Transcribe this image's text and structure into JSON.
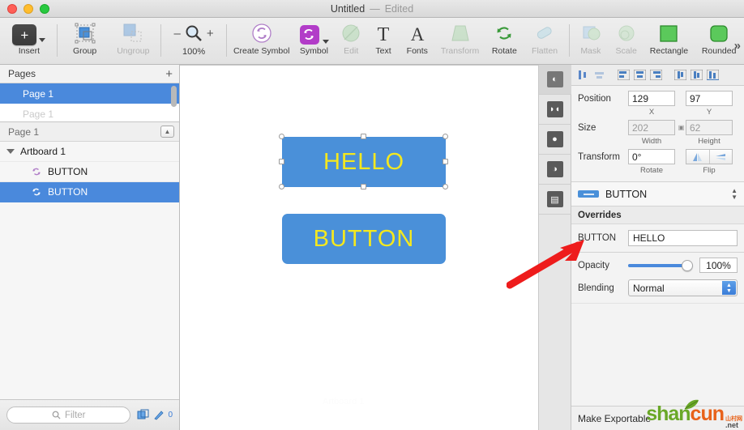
{
  "window": {
    "title": "Untitled",
    "separator": "—",
    "state": "Edited",
    "traffic": [
      "close",
      "minimize",
      "zoom"
    ]
  },
  "toolbar": {
    "items": [
      {
        "label": "Insert",
        "icon": "plus-square-icon",
        "enabled": true,
        "has_caret": true
      },
      {
        "label": "Group",
        "icon": "group-icon",
        "enabled": true
      },
      {
        "label": "Ungroup",
        "icon": "ungroup-icon",
        "enabled": false
      },
      {
        "label": "Create Symbol",
        "icon": "create-symbol-icon",
        "enabled": true
      },
      {
        "label": "Symbol",
        "icon": "symbol-icon",
        "enabled": true,
        "has_caret": true
      },
      {
        "label": "Edit",
        "icon": "edit-icon",
        "enabled": false
      },
      {
        "label": "Text",
        "icon": "text-icon",
        "enabled": true
      },
      {
        "label": "Fonts",
        "icon": "fonts-icon",
        "enabled": true
      },
      {
        "label": "Transform",
        "icon": "transform-icon",
        "enabled": false
      },
      {
        "label": "Rotate",
        "icon": "rotate-icon",
        "enabled": true
      },
      {
        "label": "Flatten",
        "icon": "flatten-icon",
        "enabled": false
      },
      {
        "label": "Mask",
        "icon": "mask-icon",
        "enabled": false
      },
      {
        "label": "Scale",
        "icon": "scale-icon",
        "enabled": false
      },
      {
        "label": "Rectangle",
        "icon": "rectangle-icon",
        "enabled": true
      },
      {
        "label": "Rounded",
        "icon": "rounded-rect-icon",
        "enabled": true
      }
    ],
    "zoom": {
      "minus": "–",
      "plus": "+",
      "level": "100%"
    },
    "overflow": "»"
  },
  "sidebar": {
    "pages_title": "Pages",
    "add_page": "+",
    "pages": [
      {
        "name": "Page 1",
        "selected": true
      },
      {
        "name": "Page 1",
        "selected": false
      }
    ],
    "layers_header": "Page 1",
    "layers": [
      {
        "name": "Artboard 1",
        "type": "artboard",
        "selected": false
      },
      {
        "name": "BUTTON",
        "type": "symbol-instance",
        "selected": false
      },
      {
        "name": "BUTTON",
        "type": "symbol-instance",
        "selected": true
      }
    ],
    "filter_placeholder": "Filter",
    "layer_count": "0"
  },
  "canvas": {
    "artboard_label": "Artboard 1",
    "shapes": [
      {
        "text": "HELLO",
        "fill": "#4a90d9",
        "text_color": "#f4e81e",
        "selected": true,
        "rounded": false
      },
      {
        "text": "BUTTON",
        "fill": "#4a90d9",
        "text_color": "#f4e81e",
        "selected": false,
        "rounded": true
      }
    ]
  },
  "inspector": {
    "icon_strip": [
      "contrast-icon",
      "halftone-icon",
      "person-icon",
      "semicircle-icon",
      "layout-icon"
    ],
    "align_buttons": [
      "align-left-icon",
      "align-center-horizontal-icon",
      "distribute-top-icon",
      "distribute-middle-icon",
      "distribute-bottom-icon",
      "align-left-edges-icon",
      "align-centers-icon",
      "align-right-edges-icon"
    ],
    "position": {
      "label": "Position",
      "x": "129",
      "y": "97",
      "x_sub": "X",
      "y_sub": "Y"
    },
    "size": {
      "label": "Size",
      "width": "202",
      "height": "62",
      "w_sub": "Width",
      "h_sub": "Height",
      "locked": true
    },
    "transform": {
      "label": "Transform",
      "rotate": "0°",
      "rotate_sub": "Rotate",
      "flip_sub": "Flip"
    },
    "symbol": {
      "name": "BUTTON"
    },
    "overrides": {
      "title": "Overrides",
      "rows": [
        {
          "label": "BUTTON",
          "value": "HELLO"
        }
      ]
    },
    "opacity": {
      "label": "Opacity",
      "value": "100%",
      "percent": 100
    },
    "blending": {
      "label": "Blending",
      "value": "Normal"
    },
    "export": {
      "label": "Make Exportable"
    }
  },
  "watermark": {
    "part1": "shan",
    "part2": "cun",
    "sub_cn": "山村网",
    "sub_net": ".net"
  },
  "annotation": {
    "type": "red-arrow",
    "color": "#ee1c1c",
    "points_to": "overrides-value-field"
  }
}
